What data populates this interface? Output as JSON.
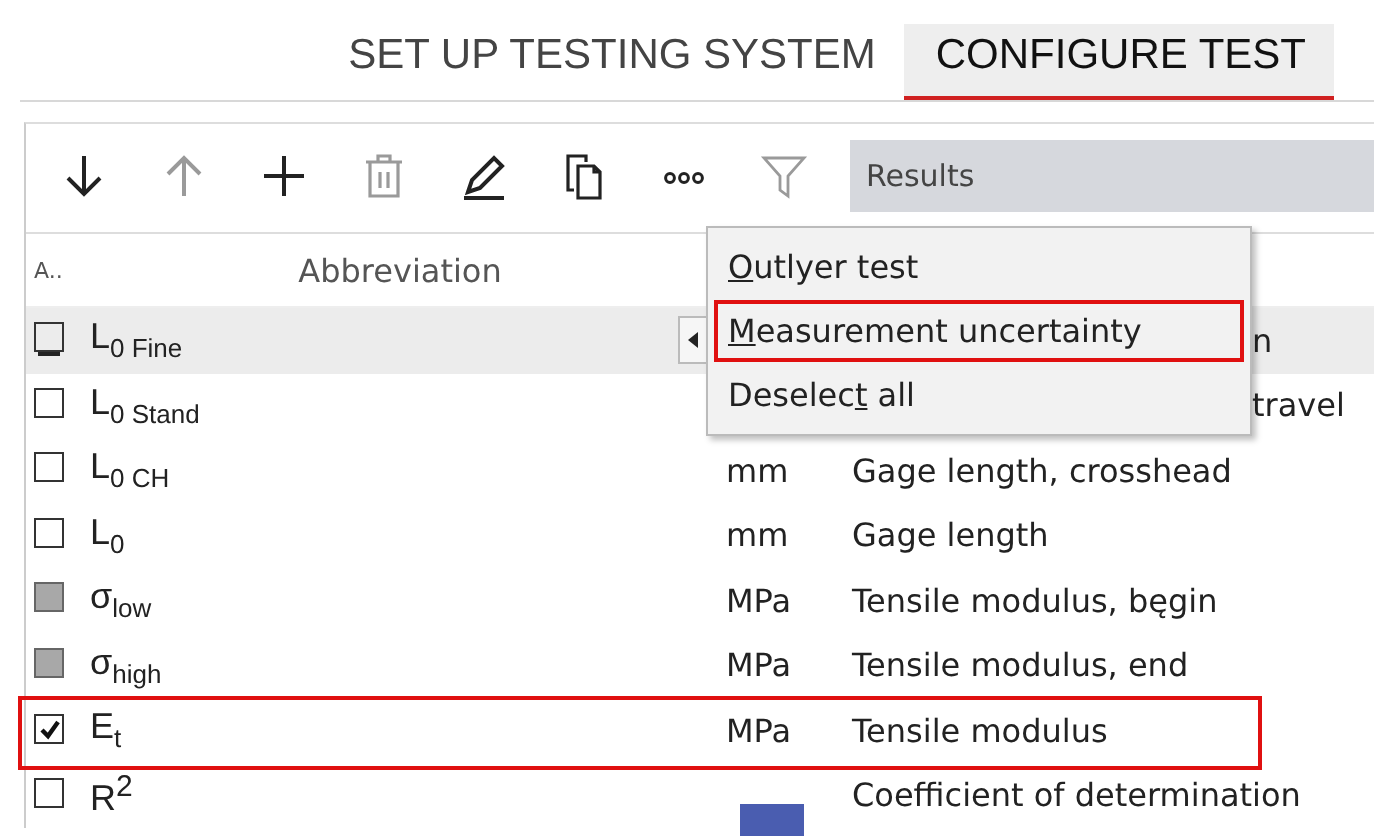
{
  "steps": [
    {
      "label": "SET UP TESTING SYSTEM",
      "selected": false
    },
    {
      "label": "CONFIGURE TEST",
      "selected": true
    }
  ],
  "toolbar": {
    "tools": [
      {
        "kind": "down",
        "disabled": false
      },
      {
        "kind": "up",
        "disabled": true
      },
      {
        "kind": "add",
        "disabled": false
      },
      {
        "kind": "delete",
        "disabled": true
      },
      {
        "kind": "edit",
        "disabled": false
      },
      {
        "kind": "copy",
        "disabled": false
      },
      {
        "kind": "more",
        "disabled": false
      },
      {
        "kind": "filter",
        "disabled": true
      }
    ],
    "field": {
      "value": "Results"
    }
  },
  "table": {
    "columns": [
      "A..",
      "Abbreviation"
    ],
    "rows": [
      {
        "kind": "covered",
        "checked": false,
        "mixed": false,
        "abbreviation": "L$_{0 Fine}$",
        "description": "n",
        "selected": true,
        "highlight": false
      },
      {
        "kind": "covered",
        "checked": false,
        "mixed": false,
        "abbreviation": "L$_{0 Stand}$",
        "description": "travel",
        "selected": false,
        "highlight": false
      },
      {
        "kind": "plain",
        "checked": false,
        "mixed": false,
        "abbreviation": "L$_{0 CH}$",
        "unit": "mm",
        "description": "Gage length, crosshead",
        "selected": false,
        "highlight": false
      },
      {
        "kind": "plain",
        "checked": false,
        "mixed": false,
        "abbreviation": "L$_{0}$",
        "unit": "mm",
        "description": "Gage length",
        "selected": false,
        "highlight": false
      },
      {
        "kind": "plain",
        "checked": false,
        "mixed": true,
        "abbreviation": "σ$_{low}$",
        "unit": "MPa",
        "description": "Tensile modulus, bęgin",
        "selected": false,
        "highlight": false
      },
      {
        "kind": "plain",
        "checked": false,
        "mixed": true,
        "abbreviation": "σ$_{high}$",
        "unit": "MPa",
        "description": "Tensile modulus, end",
        "selected": false,
        "highlight": false
      },
      {
        "kind": "plain",
        "checked": true,
        "mixed": false,
        "abbreviation": "E$_{t}$",
        "unit": "MPa",
        "description": "Tensile modulus",
        "selected": false,
        "highlight": true
      },
      {
        "kind": "plain",
        "checked": false,
        "mixed": false,
        "abbreviation": "R$^{2}$",
        "description": "Coefficient of determination",
        "selected": false,
        "highlight": false
      }
    ]
  },
  "menu": {
    "items": [
      {
        "key": "O",
        "after": "utlyer test",
        "highlight": false
      },
      {
        "key": "M",
        "after": "easurement uncertainty",
        "highlight": true
      },
      {
        "before": "Deselec",
        "key": "t",
        "after": " all",
        "highlight": false
      }
    ]
  }
}
